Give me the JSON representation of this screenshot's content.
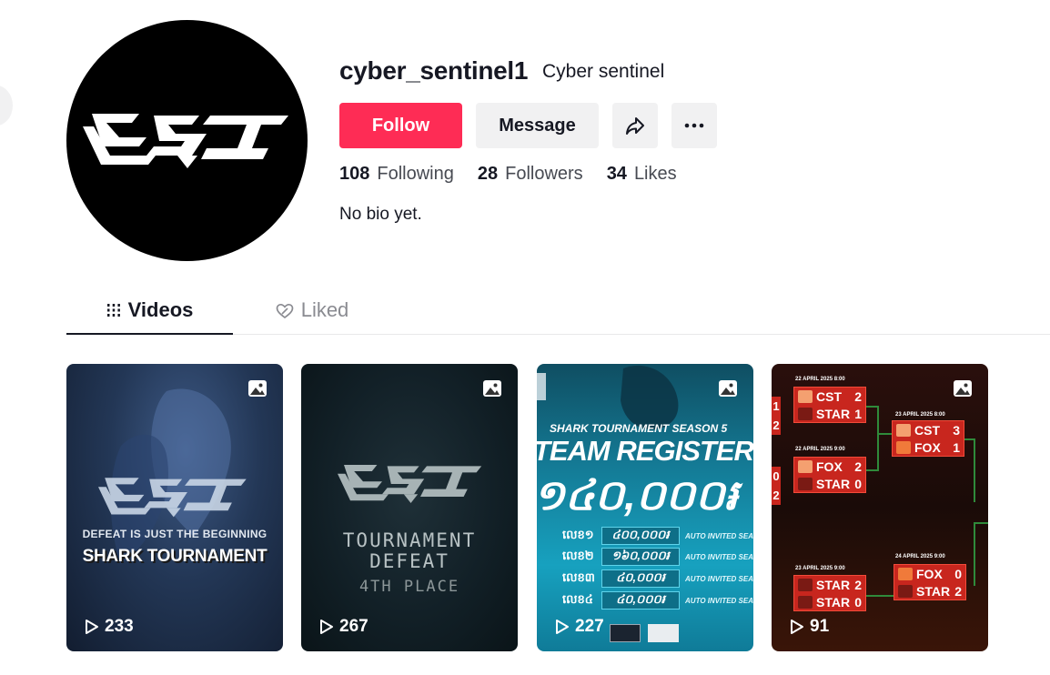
{
  "profile": {
    "username": "cyber_sentinel1",
    "nickname": "Cyber sentinel",
    "bio": "No bio yet."
  },
  "actions": {
    "follow_label": "Follow",
    "message_label": "Message"
  },
  "stats": [
    {
      "value": "108",
      "label": "Following"
    },
    {
      "value": "28",
      "label": "Followers"
    },
    {
      "value": "34",
      "label": "Likes"
    }
  ],
  "tabs": [
    {
      "label": "Videos",
      "active": true
    },
    {
      "label": "Liked",
      "active": false
    }
  ],
  "videos": [
    {
      "views": "233",
      "type": "photo",
      "subtitle": "DEFEAT IS JUST THE BEGINNING",
      "title": "SHARK TOURNAMENT"
    },
    {
      "views": "267",
      "type": "photo",
      "line1": "TOURNAMENT",
      "line2": "DEFEAT",
      "line3": "4TH PLACE"
    },
    {
      "views": "227",
      "type": "photo",
      "subtitle": "SHARK TOURNAMENT SEASON 5",
      "title": "TEAM REGISTERED",
      "amount": "១៤០,០០០៛",
      "prizes": [
        {
          "rank": "លេខ១",
          "amount": "៤០០,០០០៛",
          "note": "AUTO INVITED SEA"
        },
        {
          "rank": "លេខ២",
          "amount": "១៦០,០០០៛",
          "note": "AUTO INVITED SEA"
        },
        {
          "rank": "លេខ៣",
          "amount": "៤០,០០០៛",
          "note": "AUTO INVITED SEA"
        },
        {
          "rank": "លេខ៤",
          "amount": "៤០,០០០៛",
          "note": "AUTO INVITED SEA"
        }
      ]
    },
    {
      "views": "91",
      "type": "photo",
      "matches": [
        {
          "date": "22 APRIL 2025 8:00",
          "team1": "CST",
          "score1": "2",
          "team2": "STAR",
          "score2": "1"
        },
        {
          "date": "22 APRIL 2025 9:00",
          "team1": "FOX",
          "score1": "2",
          "team2": "STAR",
          "score2": "0"
        },
        {
          "date": "23 APRIL 2025 8:00",
          "team1": "CST",
          "score1": "3",
          "team2": "FOX",
          "score2": "1"
        },
        {
          "date": "23 APRIL 2025 9:00",
          "team1": "STAR",
          "score1": "2",
          "team2": "STAR",
          "score2": "0"
        },
        {
          "date": "24 APRIL 2025 9:00",
          "team1": "FOX",
          "score1": "0",
          "team2": "STAR",
          "score2": "2"
        }
      ]
    }
  ],
  "colors": {
    "accent": "#fe2c55",
    "button_bg": "#f1f1f2",
    "text": "#161823",
    "muted": "#474a52"
  }
}
